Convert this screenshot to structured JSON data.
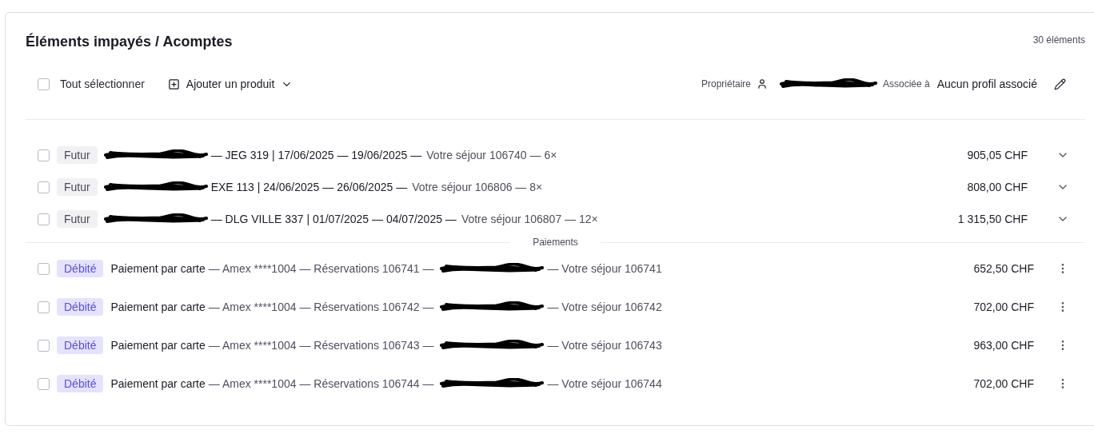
{
  "title": "Éléments impayés / Acomptes",
  "count": "30 éléments",
  "toolbar": {
    "select_all": {
      "label": "Tout sélectionner",
      "checked": false
    },
    "add_product": "Ajouter un produit",
    "owner_label": "Propriétaire",
    "associated_label": "Associée à",
    "associated_value": "Aucun profil associé"
  },
  "items": [
    {
      "checked": false,
      "badge": "Futur",
      "details": "— JEG 319 | 17/06/2025 — 19/06/2025 —",
      "reference": "Votre séjour 106740 — 6×",
      "amount": "905,05 CHF"
    },
    {
      "checked": false,
      "badge": "Futur",
      "details": "EXE 113 | 24/06/2025 — 26/06/2025 —",
      "reference": "Votre séjour 106806 — 8×",
      "amount": "808,00 CHF"
    },
    {
      "checked": false,
      "badge": "Futur",
      "details": "— DLG VILLE 337 | 01/07/2025 — 04/07/2025 —",
      "reference": "Votre séjour 106807 — 12×",
      "amount": "1 315,50 CHF"
    }
  ],
  "section_label": "Paiements",
  "payments": [
    {
      "checked": false,
      "badge": "Débité",
      "method": "Paiement par carte",
      "details": "— Amex ****1004 — Réservations 106741 —",
      "reference": "— Votre séjour 106741",
      "amount": "652,50 CHF"
    },
    {
      "checked": false,
      "badge": "Débité",
      "method": "Paiement par carte",
      "details": "— Amex ****1004 — Réservations 106742 —",
      "reference": "— Votre séjour 106742",
      "amount": "702,00 CHF"
    },
    {
      "checked": false,
      "badge": "Débité",
      "method": "Paiement par carte",
      "details": "— Amex ****1004 — Réservations 106743 —",
      "reference": "— Votre séjour 106743",
      "amount": "963,00 CHF"
    },
    {
      "checked": false,
      "badge": "Débité",
      "method": "Paiement par carte",
      "details": "— Amex ****1004 — Réservations 106744 —",
      "reference": "— Votre séjour 106744",
      "amount": "702,00 CHF"
    }
  ]
}
